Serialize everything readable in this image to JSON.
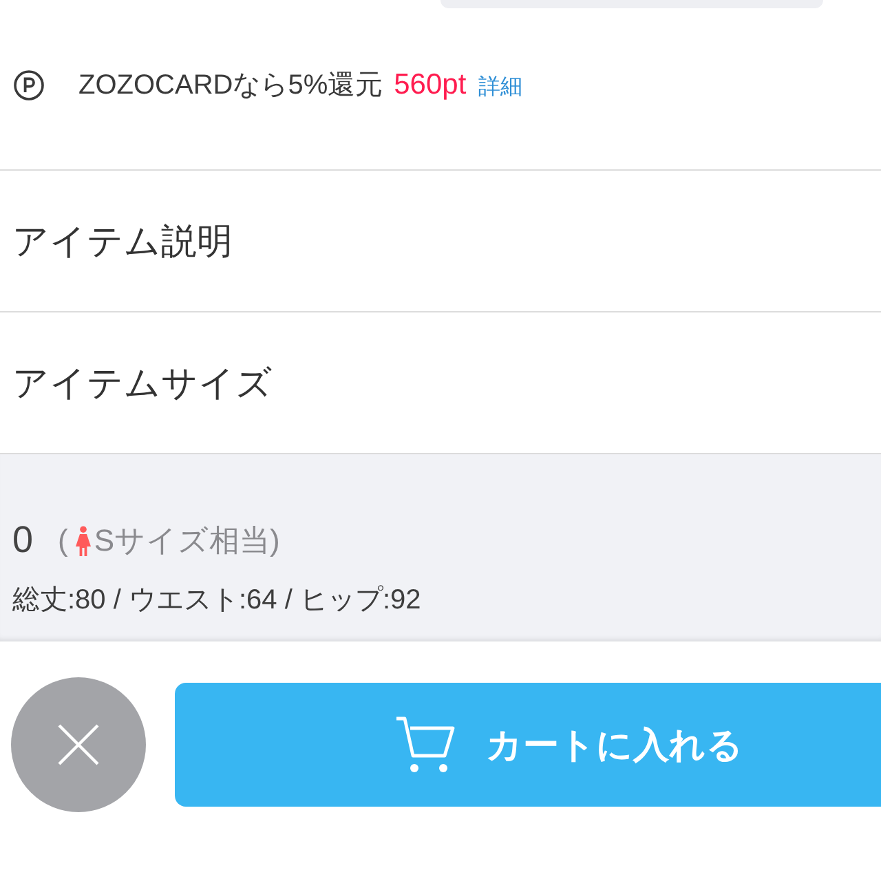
{
  "points": {
    "text": "ZOZOCARDなら5%還元",
    "amount": "560pt",
    "link": "詳細"
  },
  "sections": [
    {
      "title": "アイテム説明"
    },
    {
      "title": "アイテムサイズ"
    }
  ],
  "size": {
    "label": "0",
    "note_open": "(",
    "note": "Sサイズ相当)",
    "measurements": "総丈:80 / ウエスト:64 / ヒップ:92"
  },
  "footer": {
    "cart_button": "カートに入れる"
  }
}
